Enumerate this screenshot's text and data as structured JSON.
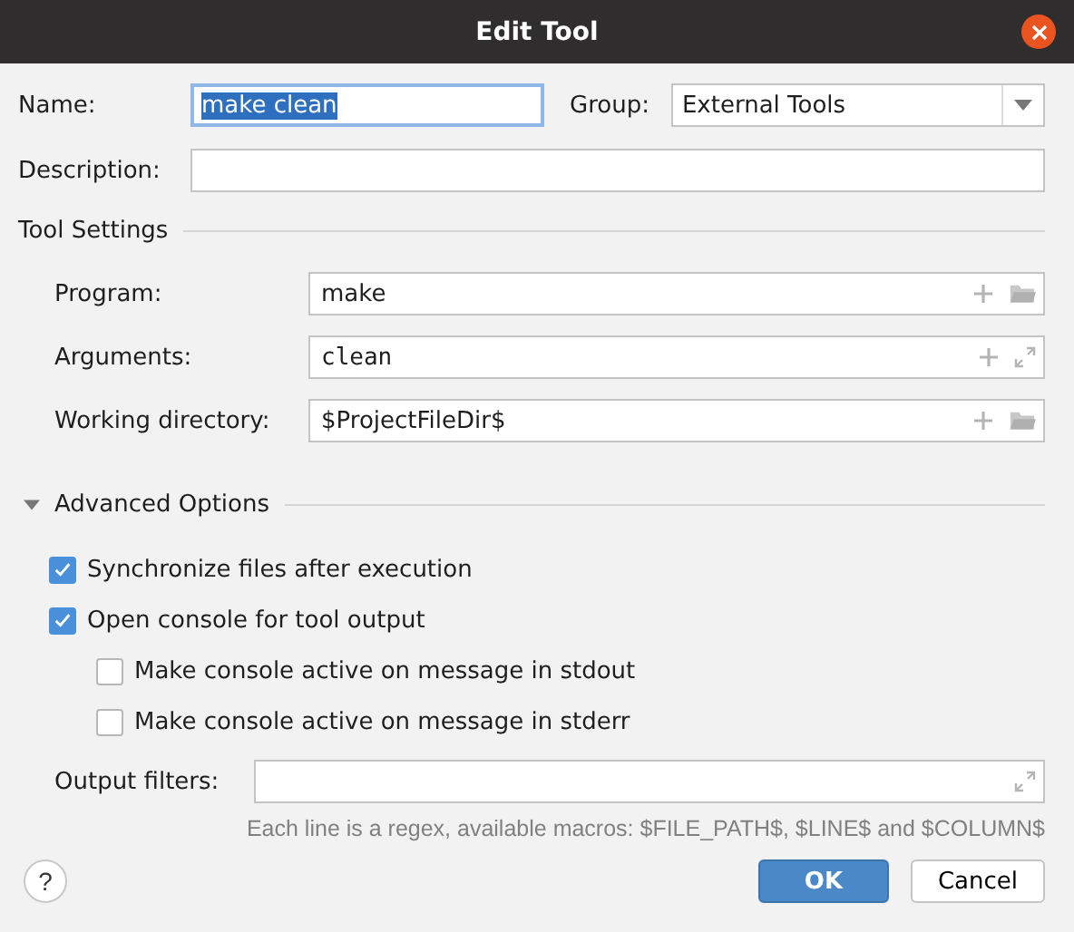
{
  "window": {
    "title": "Edit Tool"
  },
  "name": {
    "label": "Name:",
    "value": "make clean",
    "selected_text": true
  },
  "group": {
    "label": "Group:",
    "value": "External Tools"
  },
  "description": {
    "label": "Description:"
  },
  "tool_settings": {
    "title": "Tool Settings",
    "fields": [
      {
        "label": "Program:",
        "value": "make",
        "kind": "path"
      },
      {
        "label": "Arguments:",
        "value": "clean",
        "kind": "args"
      },
      {
        "label": "Working directory:",
        "value": "$ProjectFileDir$",
        "kind": "path"
      }
    ]
  },
  "advanced": {
    "title": "Advanced Options",
    "expanded": true,
    "options": [
      {
        "label": "Synchronize files after execution",
        "checked": true
      },
      {
        "label": "Open console for tool output",
        "checked": true,
        "children": [
          {
            "label": "Make console active on message in stdout",
            "checked": false
          },
          {
            "label": "Make console active on message in stderr",
            "checked": false
          }
        ]
      }
    ],
    "output_filters": {
      "label": "Output filters:"
    },
    "hint": "Each line is a regex, available macros: $FILE_PATH$, $LINE$ and $COLUMN$"
  },
  "help_button": "?",
  "buttons": [
    {
      "label": "OK",
      "default": true
    },
    {
      "label": "Cancel",
      "default": false
    }
  ]
}
